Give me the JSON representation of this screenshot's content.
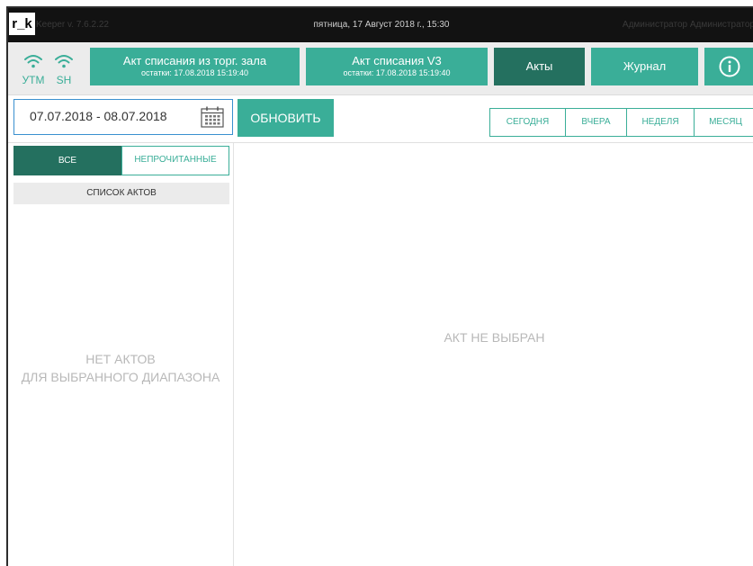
{
  "titlebar": {
    "logo": "r_k",
    "app_version": "Keeper v. 7.6.2.22",
    "datetime": "пятница, 17 Август 2018 г., 15:30",
    "user": "Администратор Администратор"
  },
  "status": {
    "utm_label": "УТМ",
    "sh_label": "SH"
  },
  "toolbar": {
    "writeoff_hall_title": "Акт списания из торг. зала",
    "writeoff_hall_sub": "остатки: 17.08.2018 15:19:40",
    "writeoff_v3_title": "Акт списания V3",
    "writeoff_v3_sub": "остатки: 17.08.2018 15:19:40",
    "acts_label": "Акты",
    "journal_label": "Журнал",
    "info_label": "i"
  },
  "filter": {
    "date_range": "07.07.2018 - 08.07.2018",
    "refresh_label": "ОБНОВИТЬ",
    "periods": [
      "СЕГОДНЯ",
      "ВЧЕРА",
      "НЕДЕЛЯ",
      "МЕСЯЦ"
    ]
  },
  "list": {
    "tab_all": "ВСЕ",
    "tab_unread": "НЕПРОЧИТАННЫЕ",
    "header": "СПИСОК АКТОВ",
    "empty_line1": "НЕТ АКТОВ",
    "empty_line2": "ДЛЯ ВЫБРАННОГО ДИАПАЗОНА"
  },
  "detail": {
    "empty": "АКТ НЕ ВЫБРАН"
  },
  "colors": {
    "accent": "#3aae98",
    "accent_dark": "#24705f",
    "titlebar": "#121212",
    "date_border": "#3a90cf"
  }
}
